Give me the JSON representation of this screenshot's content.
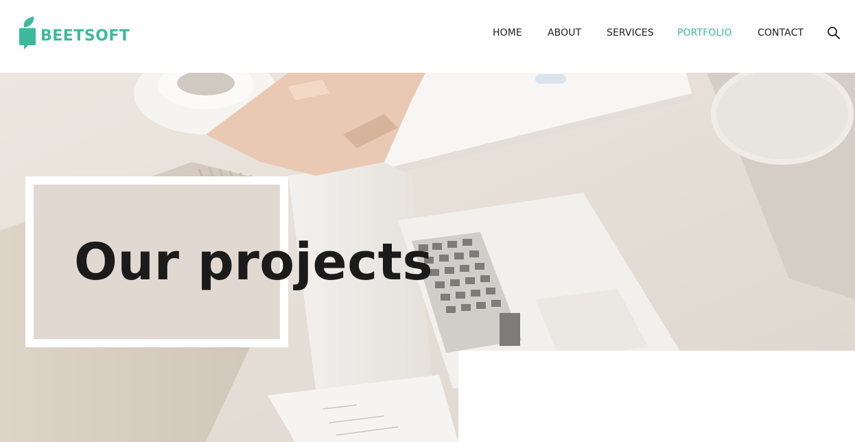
{
  "brand": {
    "name": "BEETSOFT",
    "logo_icon": "leaf-tag-icon",
    "color": "#3dba9b"
  },
  "nav": {
    "items": [
      {
        "label": "HOME",
        "active": false
      },
      {
        "label": "ABOUT",
        "active": false
      },
      {
        "label": "SERVICES",
        "active": false
      },
      {
        "label": "PORTFOLIO",
        "active": true
      },
      {
        "label": "CONTACT",
        "active": false
      }
    ],
    "search_icon": "search-icon",
    "active_color": "#3dba9b",
    "text_color": "#1e1e1e"
  },
  "hero": {
    "title": "Our projects",
    "background": "handshake-over-laptop-photo"
  }
}
